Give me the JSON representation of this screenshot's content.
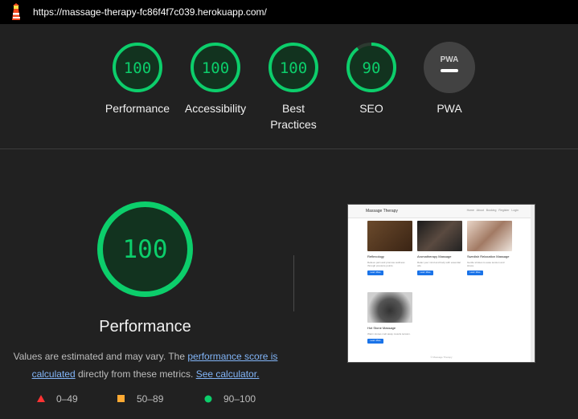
{
  "browser": {
    "url": "https://massage-therapy-fc86f4f7c039.herokuapp.com/"
  },
  "scores": [
    {
      "label": "Performance",
      "value": 100
    },
    {
      "label": "Accessibility",
      "value": 100
    },
    {
      "label": "Best Practices",
      "value": 100
    },
    {
      "label": "SEO",
      "value": 90
    },
    {
      "label": "PWA",
      "value": null,
      "badge": "PWA"
    }
  ],
  "main": {
    "score": "100",
    "score_value": 100,
    "title": "Performance",
    "note_prefix": "Values are estimated and may vary. The ",
    "note_link1": "performance score is calculated",
    "note_mid": " directly from these metrics. ",
    "note_link2": "See calculator."
  },
  "legend": [
    {
      "range": "0–49",
      "color": "#ff3333",
      "shape": "triangle"
    },
    {
      "range": "50–89",
      "color": "#ffaa33",
      "shape": "square"
    },
    {
      "range": "90–100",
      "color": "#0cce6b",
      "shape": "circle"
    }
  ],
  "colors": {
    "pass": "#0cce6b",
    "pass_bg": "#12331f",
    "pwa_bg": "#424242"
  },
  "screenshot": {
    "brand": "Massage Therapy",
    "nav_links": "Home About Booking Register Login",
    "cards": [
      {
        "title": "Reflexology",
        "desc": "Relieve pain and promote wellness through pressure points.",
        "button": "Learn More"
      },
      {
        "title": "Aromatherapy Massage",
        "desc": "Relax your mind and body with essential oils.",
        "button": "Learn More"
      },
      {
        "title": "Swedish Relaxation Massage",
        "desc": "Gentle strokes to ease tension and stress.",
        "button": "Learn More"
      },
      {
        "title": "Hot Stone Massage",
        "desc": "Warm stones melt away muscle tension.",
        "button": "Learn More"
      }
    ],
    "footer": "© Massage Therapy"
  }
}
